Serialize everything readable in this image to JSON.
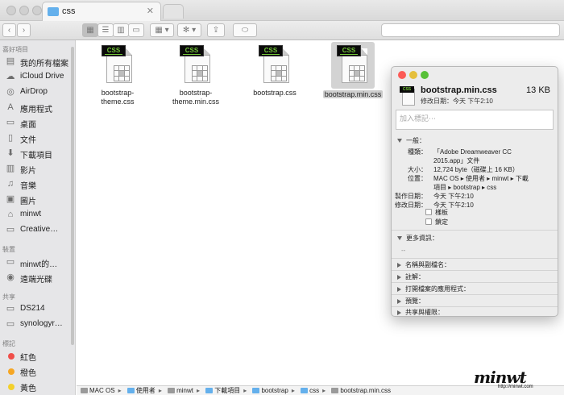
{
  "window": {
    "tab_title": "css",
    "tab_close": "✕"
  },
  "toolbar": {
    "back": "‹",
    "forward": "›",
    "views": [
      "▦",
      "☰",
      "▥",
      "▭"
    ],
    "arrange": "▦ ▾",
    "action": "✻ ▾",
    "share": "⇪",
    "tag": "⬭"
  },
  "sidebar": {
    "favorites_header": "喜好項目",
    "favorites": [
      {
        "icon": "all-files-icon",
        "glyph": "▤",
        "label": "我的所有檔案"
      },
      {
        "icon": "cloud-icon",
        "glyph": "☁",
        "label": "iCloud Drive"
      },
      {
        "icon": "airdrop-icon",
        "glyph": "◎",
        "label": "AirDrop"
      },
      {
        "icon": "applications-icon",
        "glyph": "A",
        "label": "應用程式"
      },
      {
        "icon": "desktop-icon",
        "glyph": "▭",
        "label": "桌面"
      },
      {
        "icon": "documents-icon",
        "glyph": "▯",
        "label": "文件"
      },
      {
        "icon": "downloads-icon",
        "glyph": "⬇",
        "label": "下載項目"
      },
      {
        "icon": "movies-icon",
        "glyph": "▥",
        "label": "影片"
      },
      {
        "icon": "music-icon",
        "glyph": "♫",
        "label": "音樂"
      },
      {
        "icon": "pictures-icon",
        "glyph": "▣",
        "label": "圖片"
      },
      {
        "icon": "home-icon",
        "glyph": "⌂",
        "label": "minwt"
      },
      {
        "icon": "folder-icon",
        "glyph": "▭",
        "label": "Creative…"
      }
    ],
    "devices_header": "裝置",
    "devices": [
      {
        "icon": "laptop-icon",
        "glyph": "▭",
        "label": "minwt的…"
      },
      {
        "icon": "disc-icon",
        "glyph": "◉",
        "label": "遠端光碟"
      }
    ],
    "shared_header": "共享",
    "shared": [
      {
        "icon": "server-icon",
        "glyph": "▭",
        "label": "DS214"
      },
      {
        "icon": "server-icon",
        "glyph": "▭",
        "label": "synologyr…"
      }
    ],
    "tags_header": "標記",
    "tags": [
      {
        "label": "紅色",
        "color": "#f04f4a"
      },
      {
        "label": "橙色",
        "color": "#f6a623"
      },
      {
        "label": "黃色",
        "color": "#f3d02b"
      }
    ]
  },
  "files": [
    {
      "name_line1": "bootstrap-",
      "name_line2": "theme.css",
      "badge": "CSS"
    },
    {
      "name_line1": "bootstrap-",
      "name_line2": "theme.min.css",
      "badge": "CSS"
    },
    {
      "name_line1": "bootstrap.css",
      "name_line2": "",
      "badge": "CSS"
    },
    {
      "name_line1": "bootstrap.min.css",
      "name_line2": "",
      "badge": "CSS",
      "selected": true
    }
  ],
  "pathbar": [
    "MAC OS",
    "使用者",
    "minwt",
    "下載項目",
    "bootstrap",
    "css",
    "bootstrap.min.css"
  ],
  "info": {
    "badge": "CSS",
    "filename": "bootstrap.min.css",
    "size": "13 KB",
    "modified": "修改日期：今天 下午2:10",
    "tags_placeholder": "加入標記⋯",
    "general_header": "一般：",
    "kind_label": "種類：",
    "kind_value_1": "「Adobe Dreamweaver CC",
    "kind_value_2": "2015.app」文件",
    "size_label": "大小：",
    "size_value": "12,724 byte（磁碟上 16 KB）",
    "where_label": "位置：",
    "where_value_1": "MAC OS ▸ 使用者 ▸ minwt ▸ 下載",
    "where_value_2": "項目 ▸ bootstrap ▸ css",
    "created_label": "製作日期：",
    "created_value": "今天 下午2:10",
    "modified_label": "修改日期：",
    "modified_value": "今天 下午2:10",
    "stationery_label": "樣板",
    "locked_label": "鎖定",
    "more_info_header": "更多資訊：",
    "more_info_value": "--",
    "sections": [
      "名稱與副檔名：",
      "註解：",
      "打開檔案的應用程式：",
      "預覽：",
      "共享與權限："
    ]
  },
  "watermark": {
    "text": "minwt",
    "url": "http://minwt.com"
  },
  "colors": {
    "folder_blue": "#64b0ec",
    "css_badge_green": "#74c639",
    "close_red": "#fc5b57",
    "min_yellow": "#e5bf3c",
    "max_green": "#57c038"
  }
}
